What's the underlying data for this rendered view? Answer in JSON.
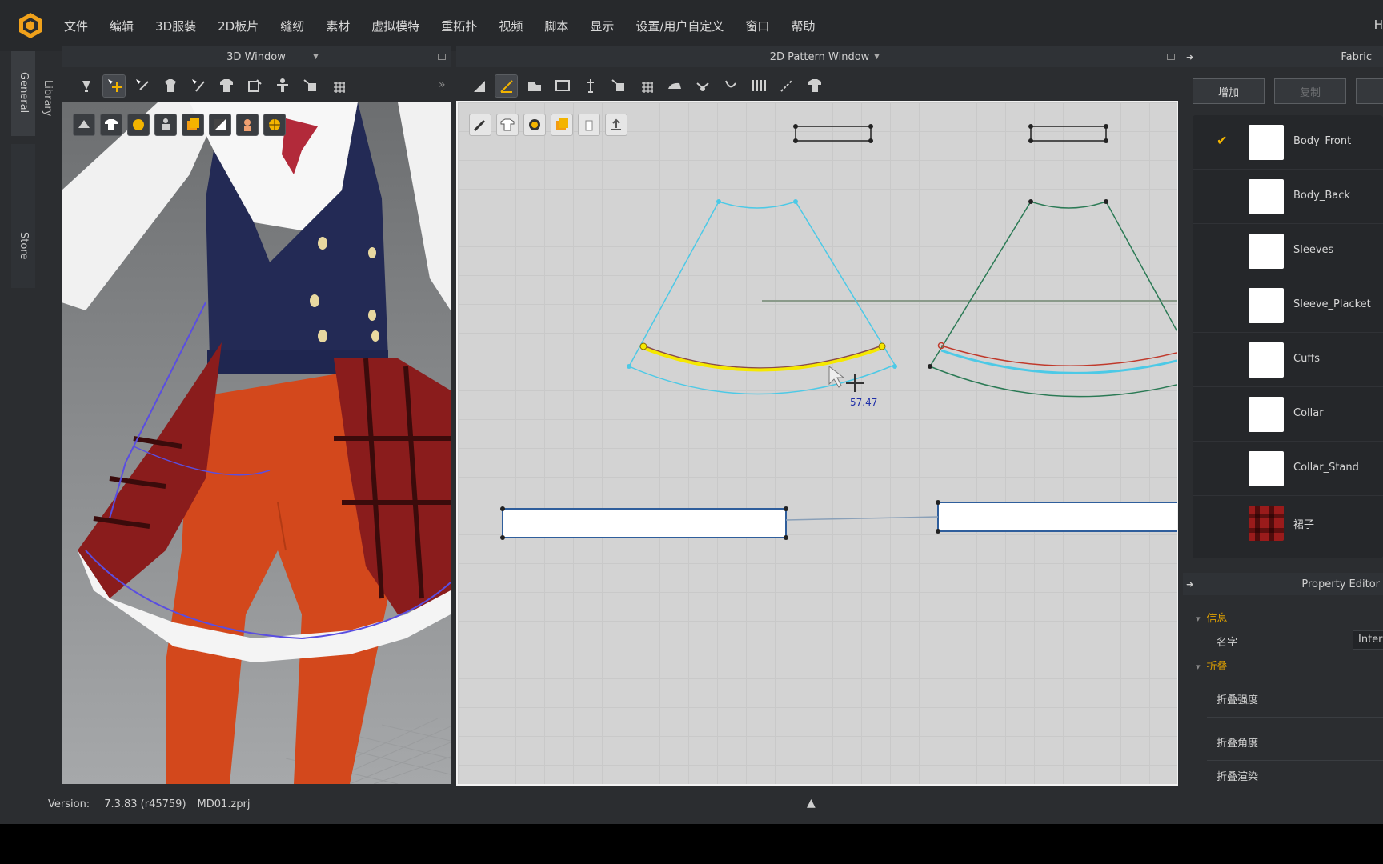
{
  "menu": {
    "items": [
      "文件",
      "编辑",
      "3D服装",
      "2D板片",
      "缝纫",
      "素材",
      "虚拟模特",
      "重拓扑",
      "视频",
      "脚本",
      "显示",
      "设置/用户自定义",
      "窗口",
      "帮助"
    ],
    "right_text": "H"
  },
  "side_tabs": {
    "general": "General",
    "library": "Library",
    "store": "Store"
  },
  "windows": {
    "view3d_title": "3D Window",
    "pattern2d_title": "2D Pattern Window",
    "fabric_title": "Fabric"
  },
  "pattern": {
    "measurement": "57.47"
  },
  "fabric": {
    "add_label": "增加",
    "copy_label": "复制",
    "items": [
      {
        "name": "Body_Front",
        "selected": true,
        "swatch": "#ffffff"
      },
      {
        "name": "Body_Back",
        "selected": false,
        "swatch": "#ffffff"
      },
      {
        "name": "Sleeves",
        "selected": false,
        "swatch": "#ffffff"
      },
      {
        "name": "Sleeve_Placket",
        "selected": false,
        "swatch": "#ffffff"
      },
      {
        "name": "Cuffs",
        "selected": false,
        "swatch": "#ffffff"
      },
      {
        "name": "Collar",
        "selected": false,
        "swatch": "#ffffff"
      },
      {
        "name": "Collar_Stand",
        "selected": false,
        "swatch": "#ffffff"
      },
      {
        "name": "裙子",
        "selected": false,
        "swatch": "plaid"
      }
    ]
  },
  "property_editor": {
    "title": "Property Editor",
    "sections": [
      {
        "label": "信息",
        "rows": [
          {
            "label": "名字",
            "value": "Inter"
          }
        ]
      },
      {
        "label": "折叠",
        "rows": [
          {
            "label": "折叠强度"
          },
          {
            "label": "折叠角度"
          },
          {
            "label": "折叠渲染"
          }
        ]
      }
    ]
  },
  "status": {
    "version_label": "Version:",
    "version_value": "7.3.83 (r45759)",
    "file_name": "MD01.zprj"
  },
  "colors": {
    "accent": "#f3b400",
    "selected_curve": "#f5e800",
    "pattern_outline_selected": "#4cc9e6",
    "pattern_outline": "#2b7a55",
    "skirt_red": "#8a1c1c",
    "tights_orange": "#d3481c",
    "vest_navy": "#232a55"
  }
}
